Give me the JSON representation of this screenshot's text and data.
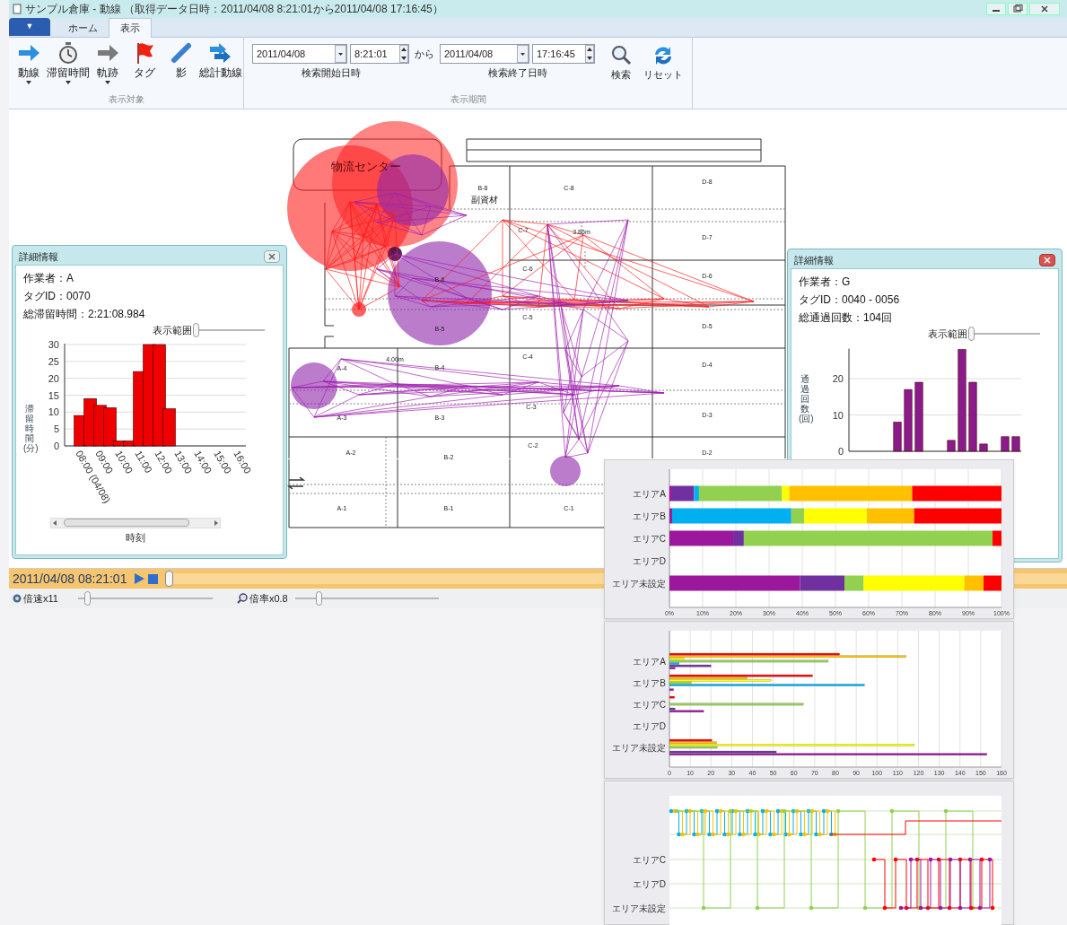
{
  "window": {
    "title": "サンプル倉庫 - 動線 （取得データ日時：2011/04/08 8:21:01から2011/04/08 17:16:45）"
  },
  "ribbon": {
    "app_menu": "▼",
    "tabs": [
      {
        "label": "ホーム",
        "selected": false
      },
      {
        "label": "表示",
        "selected": true
      }
    ],
    "display_group": {
      "label": "表示対象",
      "buttons": [
        {
          "label": "動線",
          "dropdown": true
        },
        {
          "label": "滞留時間",
          "dropdown": true
        },
        {
          "label": "軌跡",
          "dropdown": true
        },
        {
          "label": "タグ",
          "dropdown": false
        },
        {
          "label": "影",
          "dropdown": false
        },
        {
          "label": "総計動線",
          "dropdown": false
        }
      ]
    },
    "period_group": {
      "label": "表示期間",
      "start_date": "2011/04/08",
      "start_time": "8:21:01",
      "separator": "から",
      "end_date": "2011/04/08",
      "end_time": "17:16:45",
      "start_label": "検索開始日時",
      "end_label": "検索終了日時",
      "buttons": [
        "検索",
        "リセット"
      ]
    }
  },
  "map": {
    "labels": [
      "物流センター",
      "B-8",
      "C-8",
      "D-8",
      "副資材",
      "C-7",
      "3.86m",
      "D-7",
      "C-6",
      "D-6",
      "B-6",
      "C-5",
      "D-5",
      "B-5",
      "A-4",
      "4.00m",
      "B-4",
      "C-4",
      "D-4",
      "A-3",
      "B-3",
      "C-3",
      "D-3",
      "A-2",
      "B-2",
      "C-2",
      "D-2",
      "A-1",
      "B-1",
      "C-1"
    ]
  },
  "panels": [
    {
      "title": "詳細情報",
      "active": false,
      "lines": [
        "作業者：A",
        "タグID：0070",
        "総滞留時間：2:21:08.984"
      ],
      "range_label": "表示範囲",
      "range": {
        "level": 0
      },
      "chart_data": {
        "type": "bar",
        "ylabel": "滞留時間(分)",
        "xlabel": "時刻",
        "x": [
          8.25,
          8.75,
          9.25,
          9.75,
          10.25,
          10.75,
          11.25,
          11.75,
          12.25,
          12.75
        ],
        "values": [
          9,
          14,
          12,
          11.3,
          1.5,
          1.5,
          22,
          30,
          30,
          11
        ],
        "xlim": [
          7.45,
          16.64
        ],
        "ylim": [
          0,
          30
        ],
        "yticks": [
          0,
          5,
          10,
          15,
          20,
          25,
          30
        ],
        "grid": true,
        "xticks": [
          {
            "value": 8,
            "label": "08:00 (04/08)"
          },
          {
            "value": 9,
            "label": "09:00"
          },
          {
            "value": 10,
            "label": "10:00"
          },
          {
            "value": 11,
            "label": "11:00"
          },
          {
            "value": 12,
            "label": "12:00"
          },
          {
            "value": 13,
            "label": "13:00"
          },
          {
            "value": 14,
            "label": "14:00"
          },
          {
            "value": 15,
            "label": "15:00"
          },
          {
            "value": 16,
            "label": "16:00"
          }
        ]
      }
    },
    {
      "title": "詳細情報",
      "active": true,
      "lines": [
        "作業者：G",
        "タグID：0040 - 0056",
        "総通過回数：104回"
      ],
      "range_label": "表示範囲",
      "range": {
        "level": 0
      },
      "chart_data": {
        "type": "bar",
        "ylabel": "通過回数(回)",
        "values": [
          0,
          0,
          0,
          0,
          8,
          17,
          19,
          0,
          0,
          3,
          28,
          19,
          2,
          0,
          4,
          4
        ],
        "ylim": [
          0,
          28
        ],
        "yticks": [
          0,
          10,
          20
        ],
        "grid": true
      }
    }
  ],
  "timeline": {
    "time": "2011/04/08 08:21:01",
    "position": {
      "level": 0
    }
  },
  "speed": {
    "label": "倍速x11",
    "level": 0.05
  },
  "zoom": {
    "label": "倍率x0.8",
    "level": 0.15
  },
  "ratio_chart": {
    "chart_data": {
      "type": "bar",
      "orientation": "horizontal",
      "stacked": true,
      "grid": true,
      "categories": [
        "エリアA",
        "エリアB",
        "エリアC",
        "エリアD",
        "エリア未設定"
      ],
      "series": [
        {
          "color": "#9b179b",
          "values": [
            0.8,
            0.8,
            19.2,
            0,
            39.3
          ]
        },
        {
          "color": "#7030a0",
          "values": [
            6.6,
            0,
            3.2,
            0,
            13.4
          ]
        },
        {
          "color": "#00b0f0",
          "values": [
            1.5,
            35.9,
            0,
            0,
            0
          ]
        },
        {
          "color": "#92d050",
          "values": [
            25,
            3.9,
            74.9,
            0,
            5.8
          ]
        },
        {
          "color": "#ffff00",
          "values": [
            2.2,
            18.8,
            0,
            0,
            30.3
          ]
        },
        {
          "color": "#ffc000",
          "values": [
            37,
            14.3,
            0,
            0,
            5.8
          ]
        },
        {
          "color": "#ff0000",
          "values": [
            26.9,
            26.3,
            2.7,
            0,
            5.4
          ]
        }
      ],
      "xlim": [
        0,
        100
      ],
      "xticks": [
        {
          "value": 0,
          "label": "0%"
        },
        {
          "value": 10,
          "label": "10%"
        },
        {
          "value": 20,
          "label": "20%"
        },
        {
          "value": 30,
          "label": "30%"
        },
        {
          "value": 40,
          "label": "40%"
        },
        {
          "value": 50,
          "label": "50%"
        },
        {
          "value": 60,
          "label": "60%"
        },
        {
          "value": 70,
          "label": "70%"
        },
        {
          "value": 80,
          "label": "80%"
        },
        {
          "value": 90,
          "label": "90%"
        },
        {
          "value": 100,
          "label": "100%"
        }
      ]
    }
  },
  "count_chart": {
    "chart_data": {
      "type": "bar",
      "orientation": "horizontal",
      "stacked": false,
      "grid": true,
      "categories": [
        "エリアA",
        "エリアB",
        "エリアC",
        "エリアD",
        "エリア未設定"
      ],
      "series": [
        {
          "color": "#9b179b",
          "values": [
            2.7,
            2,
            16.5,
            0,
            153
          ]
        },
        {
          "color": "#7030a0",
          "values": [
            20,
            0,
            2.7,
            0,
            51.5
          ]
        },
        {
          "color": "#00b0f0",
          "values": [
            4.7,
            94,
            0,
            0,
            0
          ]
        },
        {
          "color": "#92d050",
          "values": [
            76.5,
            10.5,
            64.5,
            0,
            23
          ]
        },
        {
          "color": "#ffff00",
          "values": [
            7,
            49,
            0,
            0,
            118
          ]
        },
        {
          "color": "#ffc000",
          "values": [
            114,
            37.5,
            0,
            0,
            22.7
          ]
        },
        {
          "color": "#ff0000",
          "values": [
            82,
            69,
            2.5,
            0,
            20.5
          ]
        }
      ],
      "xlim": [
        0,
        160
      ],
      "xticks": [
        0,
        10,
        20,
        30,
        40,
        50,
        60,
        70,
        80,
        90,
        100,
        110,
        120,
        130,
        140,
        150,
        160
      ]
    }
  },
  "step_chart": {
    "lane_labels": [
      "エリアC",
      "エリアD",
      "エリア未設定"
    ]
  }
}
